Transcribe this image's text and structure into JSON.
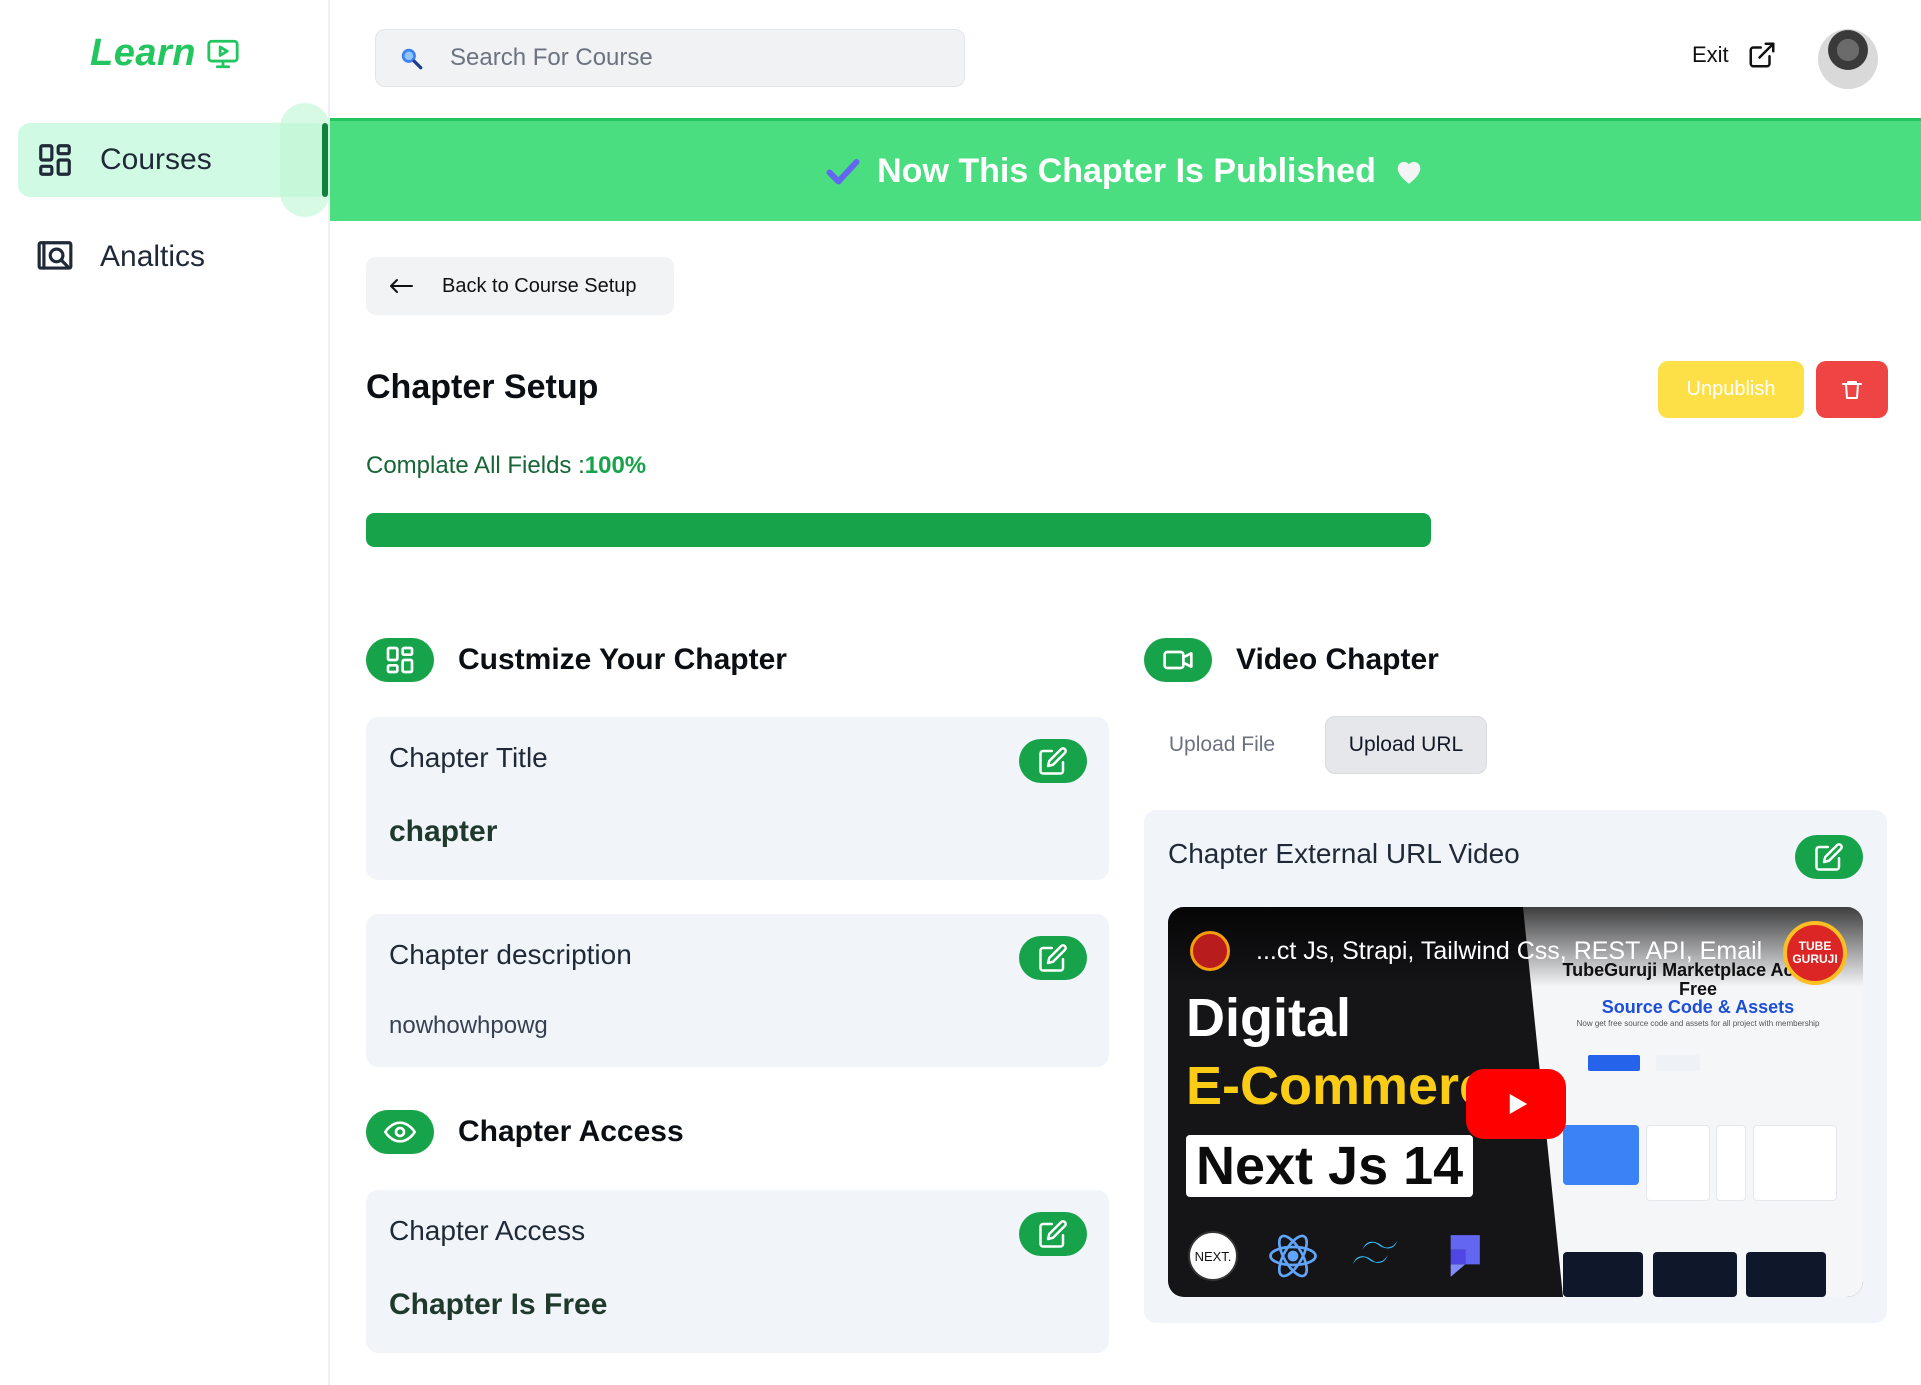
{
  "sidebar": {
    "logo": "Learn",
    "items": [
      {
        "label": "Courses",
        "icon": "dashboard-icon",
        "active": true
      },
      {
        "label": "Analtics",
        "icon": "analytics-icon",
        "active": false
      }
    ]
  },
  "header": {
    "search_placeholder": "Search For Course",
    "exit_label": "Exit"
  },
  "banner": {
    "text": "Now This Chapter Is Published",
    "color": "#4ade80"
  },
  "main": {
    "back_label": "Back to Course Setup",
    "title": "Chapter Setup",
    "unpublish_label": "Unpublish",
    "progress_label": "Complate All Fields :",
    "progress_value": "100%",
    "progress_fraction": 1.0
  },
  "customize": {
    "title": "Custmize Your Chapter",
    "title_card": {
      "label": "Chapter Title",
      "value": "chapter"
    },
    "description_card": {
      "label": "Chapter description",
      "value": "nowhowhpowg"
    }
  },
  "access": {
    "title": "Chapter Access",
    "card": {
      "label": "Chapter Access",
      "value": "Chapter Is Free"
    }
  },
  "video": {
    "title": "Video Chapter",
    "tabs": [
      "Upload File",
      "Upload URL"
    ],
    "active_tab": "Upload URL",
    "card_label": "Chapter External URL Video",
    "thumbnail": {
      "video_title": "...ct Js, Strapi, Tailwind Css, REST API, Email",
      "line1": "Digital",
      "line2": "E-Commerce",
      "line3": "Next Js 14",
      "badge": "TUBE GURUJI",
      "right_heading": "TubeGuruji Marketplace Access Free",
      "right_subheading": "Source Code & Assets",
      "right_text": "Now get free source code and assets for all project with membership",
      "next_logo": "NEXT."
    }
  },
  "colors": {
    "accent": "#16a34a",
    "accent_light": "#d1fae5",
    "warning": "#fde047",
    "danger": "#ef4444"
  }
}
